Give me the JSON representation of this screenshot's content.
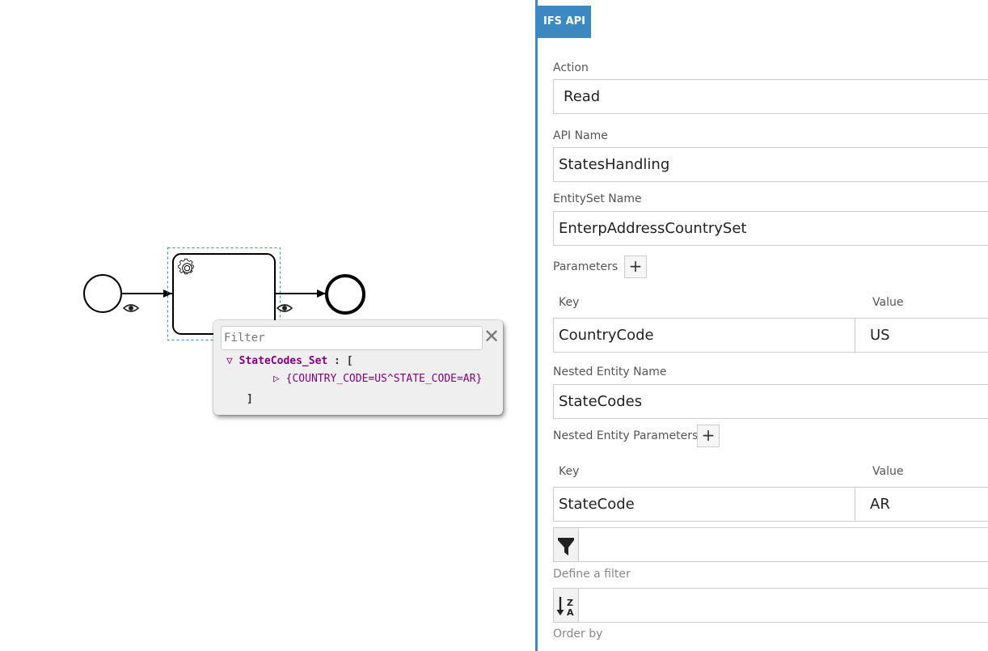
{
  "diagram": {
    "filter_placeholder": "Filter",
    "close_glyph": "✕",
    "tree": {
      "root_key": "StateCodes_Set",
      "root_sep": " : [",
      "item": "{COUNTRY_CODE=US^STATE_CODE=AR}",
      "close_bracket": "]"
    }
  },
  "panel": {
    "tab_label": "IFS API",
    "action": {
      "label": "Action",
      "value": "Read"
    },
    "api_name": {
      "label": "API Name",
      "value": "StatesHandling"
    },
    "entityset": {
      "label": "EntitySet Name",
      "value": "EnterpAddressCountrySet"
    },
    "parameters": {
      "label": "Parameters",
      "add_label": "+",
      "key_header": "Key",
      "value_header": "Value",
      "rows": [
        {
          "key": "CountryCode",
          "value": "US"
        }
      ]
    },
    "nested_entity": {
      "label": "Nested Entity Name",
      "value": "StateCodes"
    },
    "nested_parameters": {
      "label": "Nested Entity Parameters",
      "add_label": "+",
      "key_header": "Key",
      "value_header": "Value",
      "rows": [
        {
          "key": "StateCode",
          "value": "AR"
        }
      ]
    },
    "filter": {
      "label": "Define a filter",
      "value": ""
    },
    "order": {
      "label": "Order by",
      "value": "",
      "icon_top": "Z",
      "icon_bottom": "A"
    }
  },
  "colors": {
    "accent": "#3b88c3",
    "tree_text": "#7f007f",
    "selection": "#3b88c3"
  }
}
